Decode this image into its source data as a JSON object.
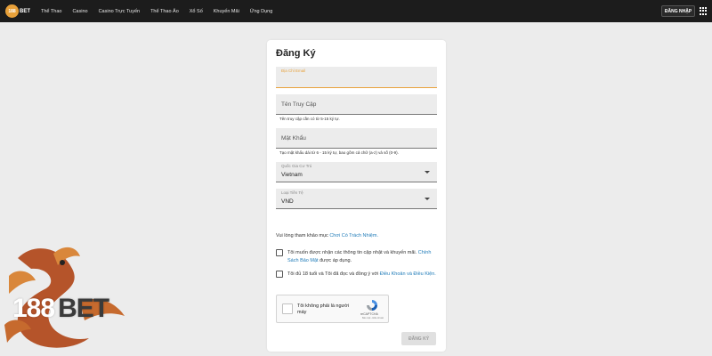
{
  "header": {
    "logo_text": "188BET",
    "nav": [
      "Thể Thao",
      "Casino",
      "Casino Trực Tuyến",
      "Thể Thao Ảo",
      "Xổ Số",
      "Khuyến Mãi",
      "Ứng Dụng"
    ],
    "login_label": "ĐĂNG NHẬP",
    "menu_icon": "grid-icon"
  },
  "form": {
    "title": "Đăng Ký",
    "email": {
      "label": "Địa Chỉ Email",
      "value": ""
    },
    "username": {
      "placeholder": "Tên Truy Cập",
      "hint": "Tên truy cập cần có từ 5-15 ký tự."
    },
    "password": {
      "placeholder": "Mật Khẩu",
      "hint": "Tạo mật khẩu dài từ 6 - 15 ký tự, bao gồm cả chữ (a-z) và số (0-9)."
    },
    "country": {
      "label": "Quốc Gia Cư Trú",
      "value": "Vietnam"
    },
    "currency": {
      "label": "Loại Tiền Tệ",
      "value": "VND"
    },
    "notice_text": "Vui lòng tham khảo mục ",
    "notice_link": "Chơi Có Trách Nhiệm.",
    "opt_in": {
      "text": "Tôi muốn được nhận các thông tin cập nhật và khuyến mãi. ",
      "link": "Chính Sách Bảo Mật",
      "suffix": " được áp dụng."
    },
    "terms": {
      "text": "Tôi đủ 18 tuổi và Tôi đã đọc và đồng ý với ",
      "link": "Điều Khoản và Điều Kiện."
    },
    "captcha": {
      "label": "Tôi không phải là người máy",
      "brand": "reCAPTCHA",
      "privacy": "Bảo mật - Điều khoản"
    },
    "submit_label": "ĐĂNG KÝ"
  },
  "background_logo": {
    "num": "188",
    "bet": "BET"
  },
  "colors": {
    "accent": "#e8a13a",
    "link": "#1f7bb8",
    "topbar": "#1c1c1c"
  }
}
